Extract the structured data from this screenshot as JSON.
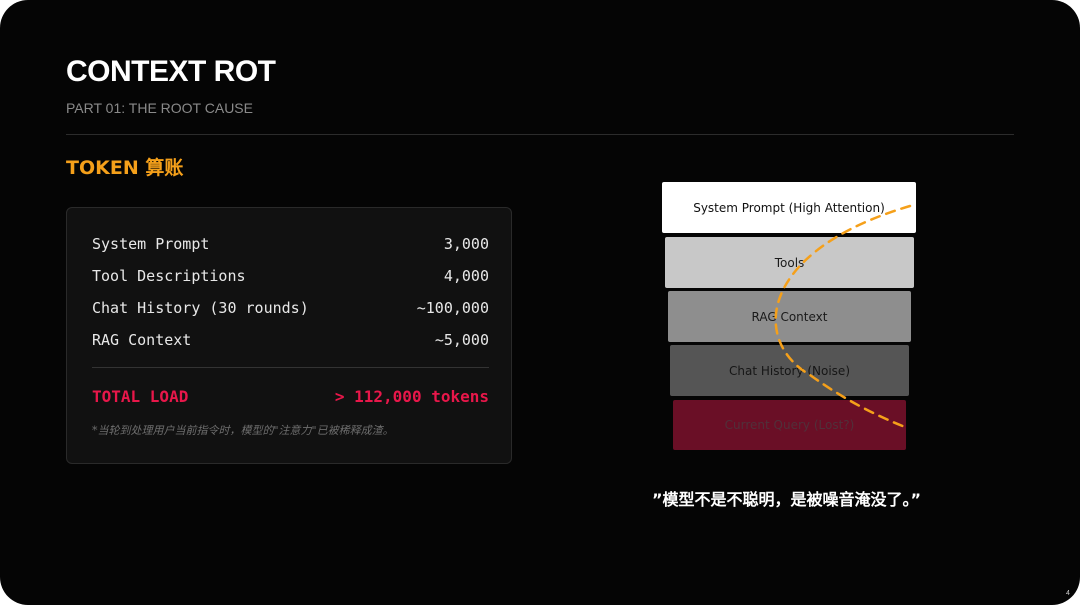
{
  "slide": {
    "title": "CONTEXT ROT",
    "subtitle": "PART 01: THE ROOT CAUSE",
    "section_heading": "TOKEN 算账",
    "page_number": "4"
  },
  "token_table": {
    "rows": [
      {
        "label": "System Prompt",
        "value": "3,000"
      },
      {
        "label": "Tool Descriptions",
        "value": "4,000"
      },
      {
        "label": "Chat History (30 rounds)",
        "value": "~100,000"
      },
      {
        "label": "RAG Context",
        "value": "~5,000"
      }
    ],
    "total_label": "TOTAL LOAD",
    "total_value": "> 112,000 tokens",
    "note": "*当轮到处理用户当前指令时，模型的\"注意力\"已被稀释成渣。"
  },
  "stack": {
    "blocks": [
      "System Prompt (High Attention)",
      "Tools",
      "RAG Context",
      "Chat History (Noise)",
      "Current Query (Lost?)"
    ]
  },
  "quote": "”模型不是不聪明，是被噪音淹没了。”",
  "colors": {
    "background": "#050505",
    "accent_orange": "#f5a01a",
    "total_red": "#e8174a",
    "query_block": "#6a0f26"
  }
}
